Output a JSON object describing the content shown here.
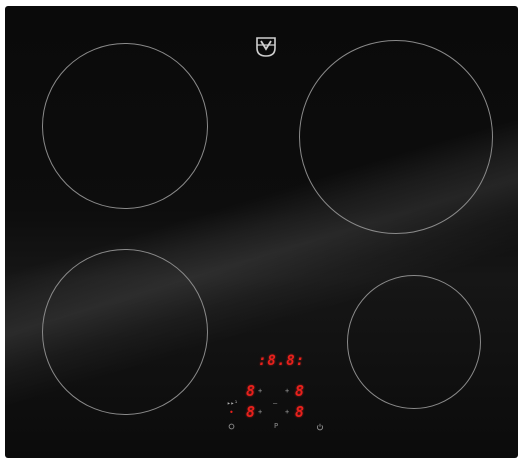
{
  "brand": {
    "logo_icon": "v-zug-logo-icon"
  },
  "cooking_zones": [
    {
      "name": "rear-left-zone"
    },
    {
      "name": "rear-right-zone"
    },
    {
      "name": "front-left-zone"
    },
    {
      "name": "front-right-zone"
    }
  ],
  "control_panel": {
    "timer_display": ":8.8:",
    "zone_displays": {
      "rear_left": "8",
      "rear_right": "8",
      "front_left": "8",
      "front_right": "8"
    },
    "plus_label": "+",
    "minus_label": "–",
    "pause_label": "P",
    "power_icon": "power-icon",
    "lock_icon": "lock-icon",
    "boost_label": "▸▸¹",
    "dot_label": "•",
    "colors": {
      "display_red": "#e8201c",
      "glass": "#0c0c0c",
      "ring": "#8a8a8a"
    }
  }
}
